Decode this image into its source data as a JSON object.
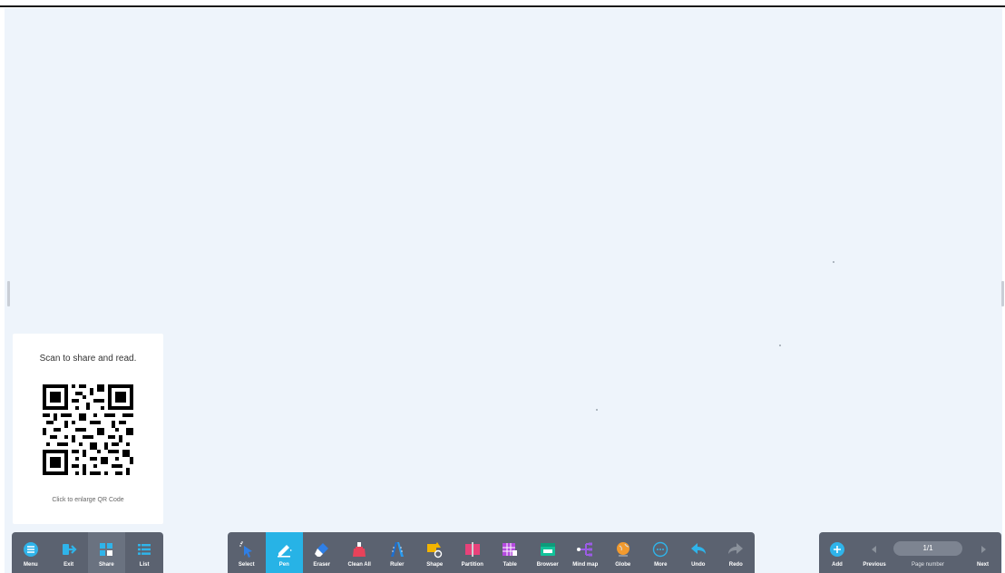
{
  "qr_panel": {
    "title": "Scan to share and read.",
    "hint": "Click to enlarge QR Code"
  },
  "left_bar": {
    "items": [
      {
        "label": "Menu",
        "icon": "menu-icon"
      },
      {
        "label": "Exit",
        "icon": "exit-icon"
      },
      {
        "label": "Share",
        "icon": "share-icon"
      },
      {
        "label": "List",
        "icon": "list-icon"
      }
    ]
  },
  "toolbar": {
    "items": [
      {
        "label": "Select",
        "icon": "select-icon"
      },
      {
        "label": "Pen",
        "icon": "pen-icon",
        "active": true
      },
      {
        "label": "Eraser",
        "icon": "eraser-icon"
      },
      {
        "label": "Clean All",
        "icon": "clean-all-icon"
      },
      {
        "label": "Ruler",
        "icon": "ruler-icon"
      },
      {
        "label": "Shape",
        "icon": "shape-icon"
      },
      {
        "label": "Partition",
        "icon": "partition-icon"
      },
      {
        "label": "Table",
        "icon": "table-icon"
      },
      {
        "label": "Browser",
        "icon": "browser-icon"
      },
      {
        "label": "Mind map",
        "icon": "mind-map-icon"
      },
      {
        "label": "Globe",
        "icon": "globe-icon"
      },
      {
        "label": "More",
        "icon": "more-icon"
      },
      {
        "label": "Undo",
        "icon": "undo-icon"
      },
      {
        "label": "Redo",
        "icon": "redo-icon"
      }
    ]
  },
  "page_nav": {
    "add_label": "Add",
    "previous_label": "Previous",
    "page_value": "1/1",
    "page_number_label": "Page number",
    "next_label": "Next"
  },
  "colors": {
    "board": "#eef4fb",
    "bar": "#5b6270",
    "active": "#27b3e6"
  }
}
